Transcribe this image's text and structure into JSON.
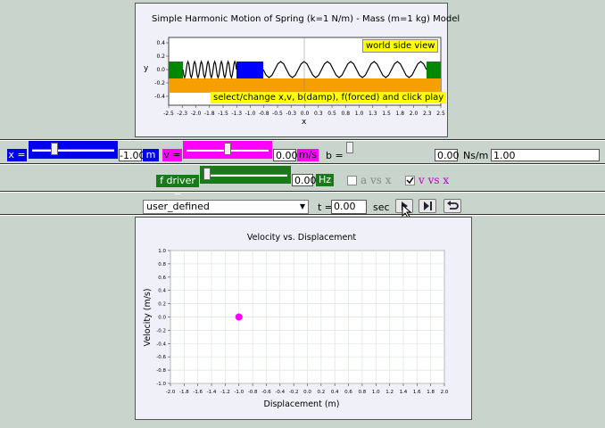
{
  "world_panel": {
    "title": "Simple Harmonic Motion of Spring (k=1 N/m) - Mass (m=1 kg) Model",
    "view_button": "world side view",
    "instruction": "select/change x,v, b(damp), f(forced) and click play",
    "y_axis_label": "y",
    "x_axis_label": "x",
    "y_ticks": [
      "0.4",
      "0.2",
      "0.0",
      "-0.2",
      "-0.4"
    ],
    "x_ticks": [
      "-2.5",
      "-2.3",
      "-2.0",
      "-1.8",
      "-1.5",
      "-1.3",
      "-1.0",
      "-0.8",
      "-0.5",
      "-0.3",
      "0.0",
      "0.3",
      "0.5",
      "0.8",
      "1.0",
      "1.3",
      "1.5",
      "1.8",
      "2.0",
      "2.3",
      "2.5"
    ]
  },
  "controls": {
    "x_label": "x =",
    "x_value": "-1.00",
    "x_unit": "m",
    "x_slider_fraction": 0.25,
    "v_label": "v =",
    "v_value": "0.00",
    "v_unit": "m/s",
    "v_slider_fraction": 0.5,
    "b_label": "b =",
    "b_value": "0.00",
    "b_unit": "Ns/m",
    "b_extra_value": "1.00",
    "fdriver_label": "f driver =",
    "fdriver_value": "0.00",
    "fdriver_unit": "Hz",
    "fdriver_slider_fraction": 0.0,
    "a_vs_x": "a vs x",
    "a_vs_x_checked": false,
    "v_vs_x": "v vs x",
    "v_vs_x_checked": true,
    "mode_select": "user_defined",
    "t_label": "t =",
    "t_value": "0.00",
    "t_unit": "sec"
  },
  "colors": {
    "x_accent": "#0000ee",
    "v_accent": "#ff00ff",
    "f_accent": "#1a7a1a",
    "ground": "#f5a000",
    "mass": "#0000ff",
    "wall": "#008800",
    "label_bg": "#ffff00"
  },
  "chart_data": {
    "type": "scatter",
    "title": "Velocity vs. Displacement",
    "xlabel": "Displacement (m)",
    "ylabel": "Velocity (m/s)",
    "xlim": [
      -2.0,
      2.0
    ],
    "ylim": [
      -1.0,
      1.0
    ],
    "x_ticks": [
      "-2.0",
      "-1.8",
      "-1.6",
      "-1.4",
      "-1.2",
      "-1.0",
      "-0.8",
      "-0.6",
      "-0.4",
      "-0.2",
      "0.0",
      "0.2",
      "0.4",
      "0.6",
      "0.8",
      "1.0",
      "1.2",
      "1.4",
      "1.6",
      "1.8",
      "2.0"
    ],
    "y_ticks": [
      "1.0",
      "0.8",
      "0.6",
      "0.4",
      "0.2",
      "0.0",
      "-0.2",
      "-0.4",
      "-0.6",
      "-0.8",
      "-1.0"
    ],
    "grid": true,
    "series": [
      {
        "points": [
          {
            "x": -1.0,
            "y": 0.0
          }
        ],
        "color": "#ff00ff"
      }
    ]
  }
}
